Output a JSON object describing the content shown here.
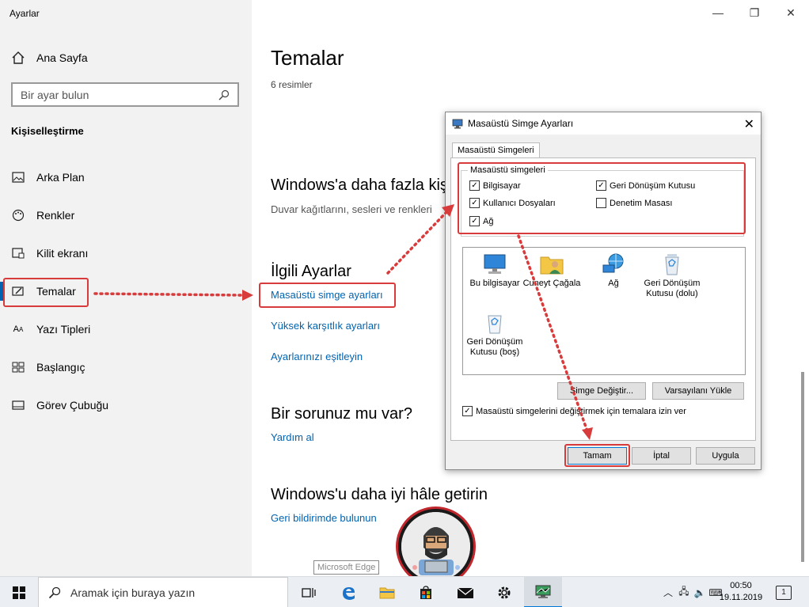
{
  "sidebar": {
    "app_title": "Ayarlar",
    "home": "Ana Sayfa",
    "search_placeholder": "Bir ayar bulun",
    "section": "Kişiselleştirme",
    "items": [
      {
        "label": "Arka Plan",
        "icon": "picture-icon"
      },
      {
        "label": "Renkler",
        "icon": "palette-icon"
      },
      {
        "label": "Kilit ekranı",
        "icon": "lock-screen-icon"
      },
      {
        "label": "Temalar",
        "icon": "brush-icon"
      },
      {
        "label": "Yazı Tipleri",
        "icon": "font-icon"
      },
      {
        "label": "Başlangıç",
        "icon": "start-icon"
      },
      {
        "label": "Görev Çubuğu",
        "icon": "taskbar-icon"
      }
    ]
  },
  "main": {
    "title": "Temalar",
    "count": "6 resimler",
    "more_heading": "Windows'a daha fazla kiş",
    "more_sub": "Duvar kağıtlarını, sesleri ve renkleri",
    "related_heading": "İlgili Ayarlar",
    "links": [
      "Masaüstü simge ayarları",
      "Yüksek karşıtlık ayarları",
      "Ayarlarınızı eşitleyin"
    ],
    "problem_heading": "Bir sorunuz mu var?",
    "help_link": "Yardım al",
    "improve_heading": "Windows'u daha iyi hâle getirin",
    "feedback_link": "Geri bildirimde bulunun"
  },
  "dialog": {
    "title": "Masaüstü Simge Ayarları",
    "tab": "Masaüstü Simgeleri",
    "group_label": "Masaüstü simgeleri",
    "checkboxes": {
      "computer": "Bilgisayar",
      "user_files": "Kullanıcı Dosyaları",
      "network": "Ağ",
      "recycle_bin": "Geri Dönüşüm Kutusu",
      "control_panel": "Denetim Masası"
    },
    "icons": {
      "this_pc": "Bu bilgisayar",
      "user": "Cuneyt Çağala",
      "network": "Ağ",
      "bin_full": "Geri Dönüşüm Kutusu (dolu)",
      "bin_empty": "Geri Dönüşüm Kutusu (boş)"
    },
    "change_icon_btn": "Simge Değiştir...",
    "restore_default_btn": "Varsayılanı Yükle",
    "allow_themes": "Masaüstü simgelerini değiştirmek için temalara izin ver",
    "ok": "Tamam",
    "cancel": "İptal",
    "apply": "Uygula"
  },
  "taskbar": {
    "search_placeholder": "Aramak için buraya yazın",
    "tooltip": "Microsoft Edge",
    "time": "00:50",
    "date": "19.11.2019",
    "notifications": "1"
  },
  "colors": {
    "accent": "#0063b1",
    "annotation": "#d83b3b"
  }
}
